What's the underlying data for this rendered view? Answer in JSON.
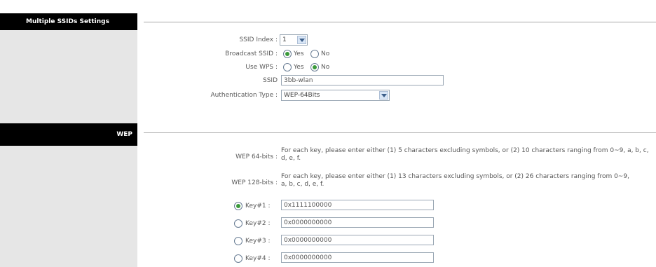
{
  "ssid_section": {
    "title": "Multiple SSIDs Settings",
    "ssid_index_label": "SSID Index :",
    "ssid_index_value": "1",
    "broadcast_label": "Broadcast SSID :",
    "broadcast_yes": "Yes",
    "broadcast_no": "No",
    "broadcast_selected": "Yes",
    "wps_label": "Use WPS :",
    "wps_yes": "Yes",
    "wps_no": "No",
    "wps_selected": "No",
    "ssid_label": "SSID",
    "ssid_value": "3bb-wlan",
    "auth_label": "Authentication Type :",
    "auth_value": "WEP-64Bits"
  },
  "wep_section": {
    "title": "WEP",
    "wep64_label": "WEP 64-bits :",
    "wep64_desc": "For each key, please enter either (1) 5 characters excluding symbols, or (2) 10 characters ranging from 0~9, a, b, c, d, e, f.",
    "wep128_label": "WEP 128-bits :",
    "wep128_desc": "For each key, please enter either (1) 13 characters excluding symbols, or (2) 26 characters ranging from 0~9, a, b, c, d, e, f.",
    "keys": [
      {
        "label": "Key#1 :",
        "value": "0x1111100000",
        "selected": true
      },
      {
        "label": "Key#2 :",
        "value": "0x0000000000",
        "selected": false
      },
      {
        "label": "Key#3 :",
        "value": "0x0000000000",
        "selected": false
      },
      {
        "label": "Key#4 :",
        "value": "0x0000000000",
        "selected": false
      }
    ]
  }
}
